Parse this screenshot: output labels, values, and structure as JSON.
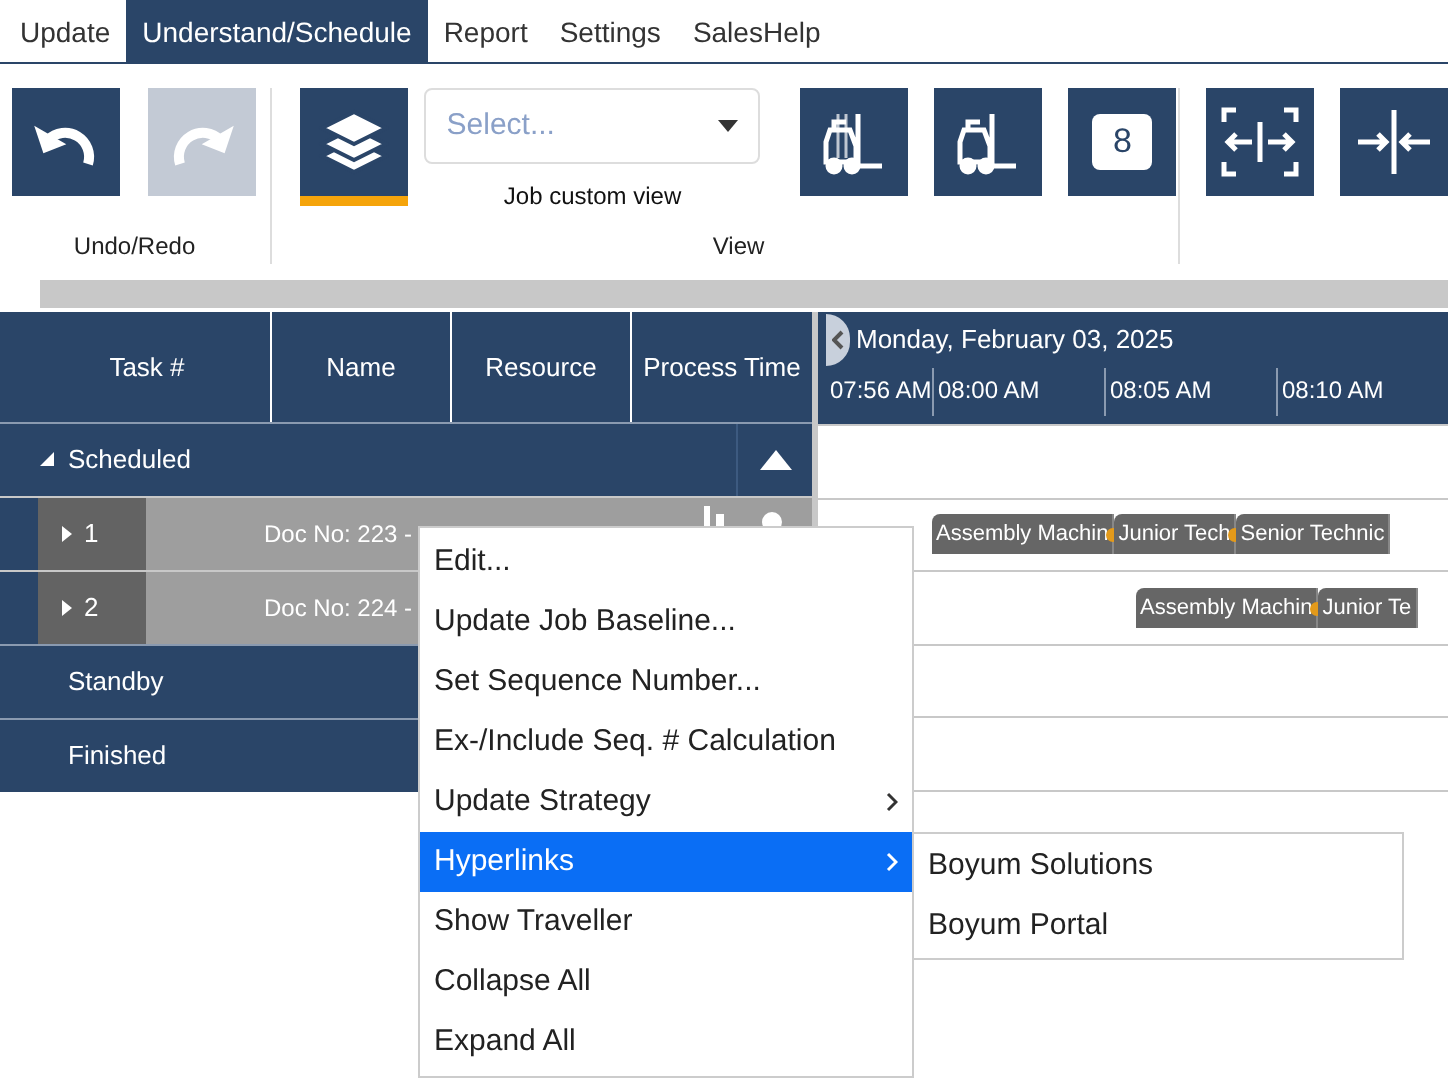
{
  "tabs": [
    {
      "label": "Update",
      "selected": false
    },
    {
      "label": "Understand/Schedule",
      "selected": true
    },
    {
      "label": "Report",
      "selected": false
    },
    {
      "label": "Settings",
      "selected": false
    },
    {
      "label": "SalesHelp",
      "selected": false
    }
  ],
  "ribbon": {
    "undo_redo": {
      "label": "Undo/Redo",
      "undo_disabled": false,
      "redo_disabled": true
    },
    "view": {
      "label": "View",
      "layers_selected": true,
      "custom_view": {
        "placeholder": "Select...",
        "caption": "Job custom view"
      },
      "calendar_day": "8"
    }
  },
  "grid": {
    "columns": [
      "Task #",
      "Name",
      "Resource",
      "Process Time"
    ],
    "groups": [
      {
        "label": "Scheduled",
        "expanded": true,
        "rows": [
          {
            "task": "1",
            "text": "Doc No: 223 -"
          },
          {
            "task": "2",
            "text": "Doc No: 224 -"
          }
        ]
      },
      {
        "label": "Standby"
      },
      {
        "label": "Finished"
      }
    ]
  },
  "timeline": {
    "date": "Monday, February 03, 2025",
    "times": [
      "07:56 AM",
      "08:00 AM",
      "08:05 AM",
      "08:10 AM"
    ],
    "lanes": [
      {
        "bars": [
          {
            "label": "Assembly Machin"
          },
          {
            "label": "Junior Tech"
          },
          {
            "label": "Senior Technic"
          }
        ]
      },
      {
        "bars": [
          {
            "label": "Assembly Machin"
          },
          {
            "label": "Junior Te"
          }
        ]
      }
    ]
  },
  "context_menu": {
    "items": [
      {
        "label": "Edit...",
        "submenu": false,
        "selected": false
      },
      {
        "label": "Update Job Baseline...",
        "submenu": false,
        "selected": false
      },
      {
        "label": "Set Sequence Number...",
        "submenu": false,
        "selected": false
      },
      {
        "label": "Ex-/Include Seq. # Calculation",
        "submenu": false,
        "selected": false
      },
      {
        "label": "Update Strategy",
        "submenu": true,
        "selected": false
      },
      {
        "label": "Hyperlinks",
        "submenu": true,
        "selected": true
      },
      {
        "label": "Show Traveller",
        "submenu": false,
        "selected": false
      },
      {
        "label": "Collapse All",
        "submenu": false,
        "selected": false
      },
      {
        "label": "Expand All",
        "submenu": false,
        "selected": false
      }
    ],
    "submenu": [
      "Boyum Solutions",
      "Boyum Portal"
    ]
  }
}
